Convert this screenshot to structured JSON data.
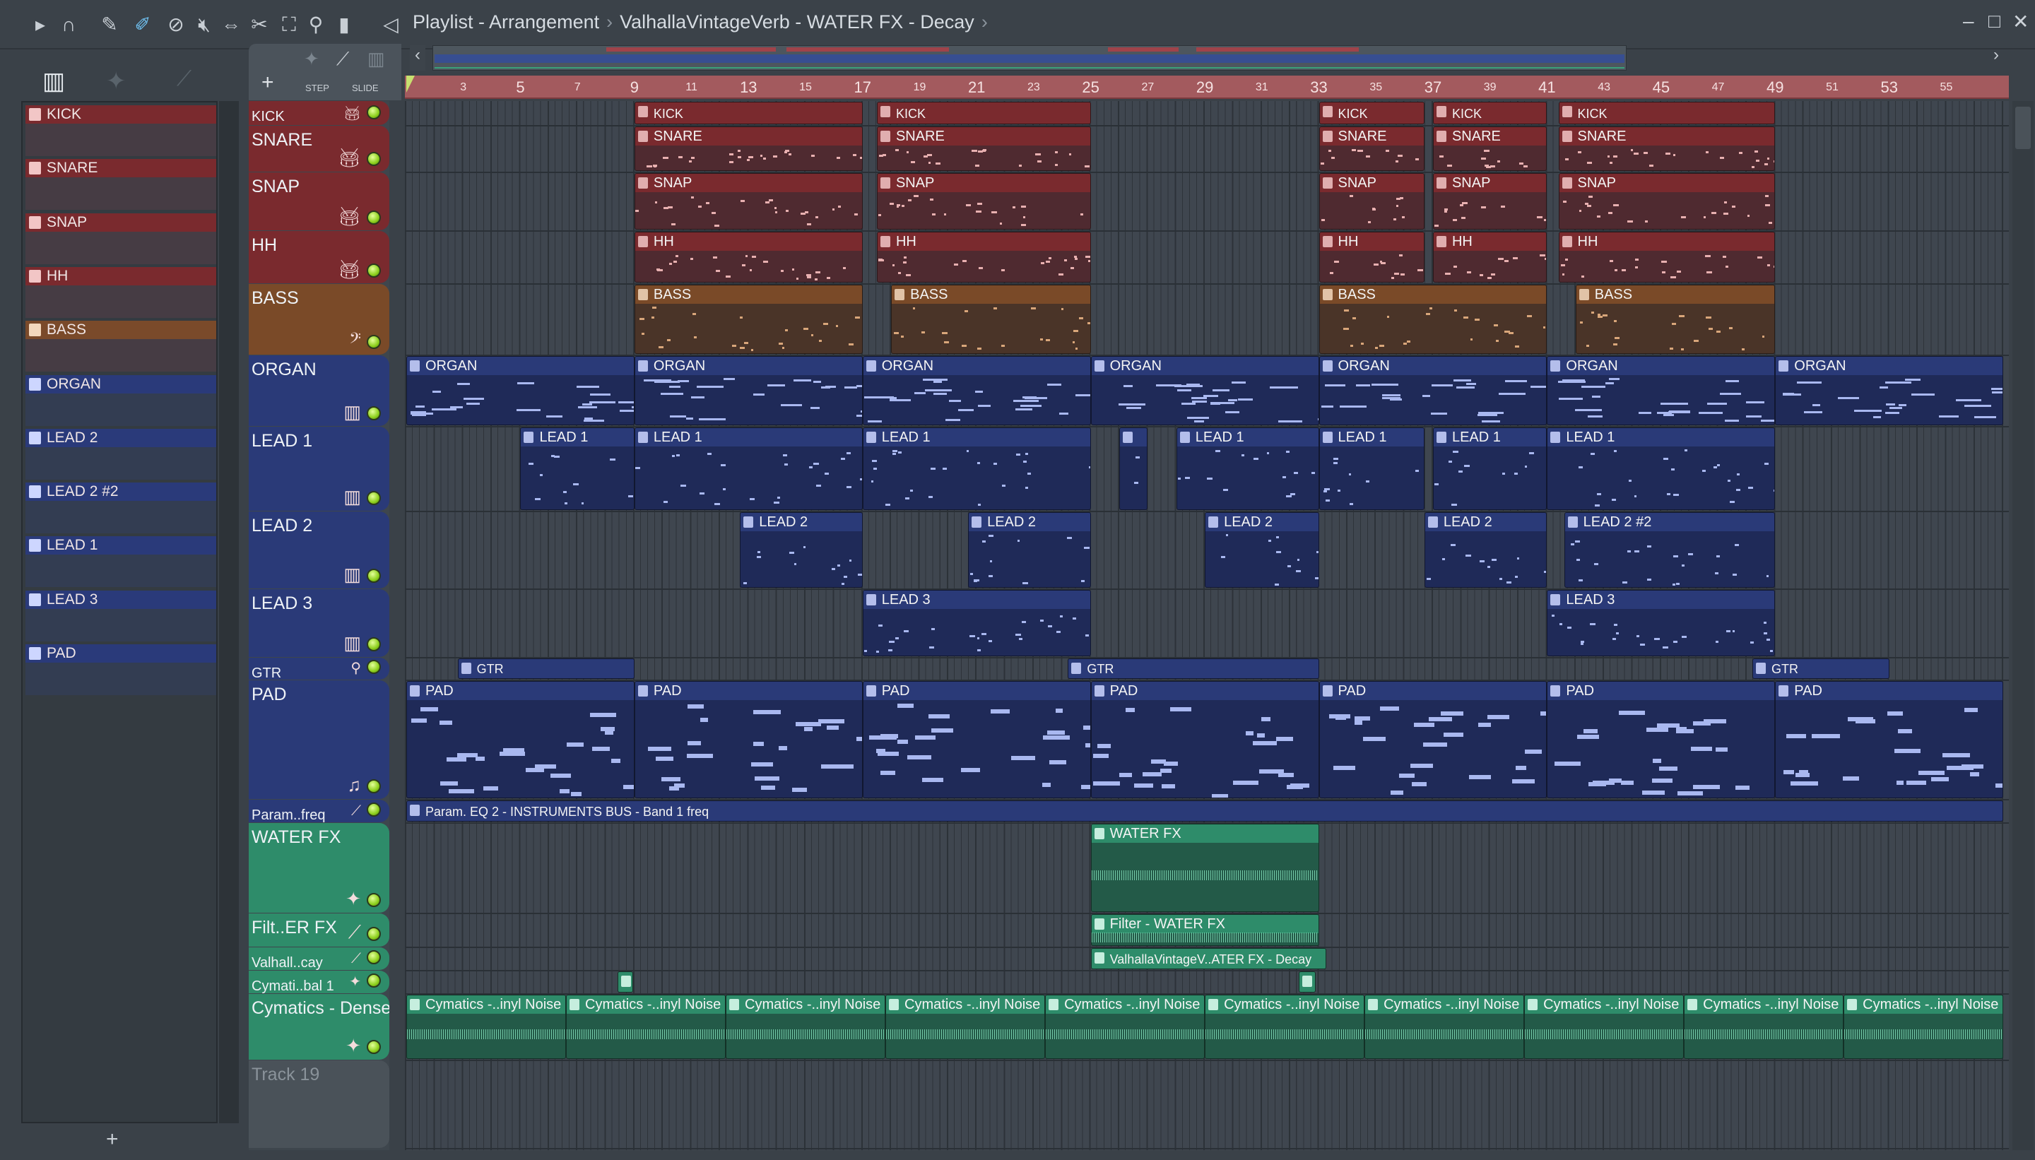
{
  "toolbar": {
    "icons": [
      "play-arrow-icon",
      "magnet-icon",
      "pencil-icon",
      "paint-brush-icon",
      "delete-icon",
      "mute-icon",
      "slip-icon",
      "slice-icon",
      "select-icon",
      "zoom-icon",
      "playback-icon",
      "speaker-icon"
    ],
    "title": "Playlist - Arrangement",
    "subtitle": "ValhallaVintageVerb - WATER FX - Decay",
    "step_label": "STEP",
    "slide_label": "SLIDE",
    "add_label": "+"
  },
  "picker": {
    "items": [
      {
        "name": "KICK",
        "color": "#7a2a2e"
      },
      {
        "name": "SNARE",
        "color": "#7a2a2e"
      },
      {
        "name": "SNAP",
        "color": "#7a2a2e"
      },
      {
        "name": "HH",
        "color": "#7a2a2e"
      },
      {
        "name": "BASS",
        "color": "#7a4a2a"
      },
      {
        "name": "ORGAN",
        "color": "#2a3a7a"
      },
      {
        "name": "LEAD 2",
        "color": "#2a3a7a"
      },
      {
        "name": "LEAD 2 #2",
        "color": "#2a3a7a"
      },
      {
        "name": "LEAD 1",
        "color": "#2a3a7a"
      },
      {
        "name": "LEAD 3",
        "color": "#2a3a7a"
      },
      {
        "name": "PAD",
        "color": "#2a3a7a"
      }
    ],
    "add_label": "+"
  },
  "ruler": {
    "ticks": [
      3,
      5,
      7,
      9,
      11,
      13,
      15,
      17,
      19,
      21,
      23,
      25,
      27,
      29,
      31,
      33,
      35,
      37,
      39,
      41,
      43,
      45,
      47,
      49,
      51,
      53,
      55
    ]
  },
  "colors": {
    "red": "#7a2a2e",
    "brown": "#7a4a28",
    "blue": "#2a3a78",
    "green": "#2e8c6a",
    "ruler": "#a35a5e"
  },
  "tracks": [
    {
      "name": "KICK",
      "kind": "red",
      "icon": "drum-icon",
      "clips": [
        [
          9,
          17,
          "KICK"
        ],
        [
          17.5,
          25,
          "KICK"
        ],
        [
          33,
          36.7,
          "KICK"
        ],
        [
          37,
          41,
          "KICK"
        ],
        [
          41.4,
          49,
          "KICK"
        ]
      ]
    },
    {
      "name": "SNARE",
      "kind": "red",
      "icon": "drum-icon",
      "clips": [
        [
          9,
          17,
          "SNARE"
        ],
        [
          17.5,
          25,
          "SNARE"
        ],
        [
          33,
          36.7,
          "SNARE"
        ],
        [
          37,
          41,
          "SNARE"
        ],
        [
          41.4,
          49,
          "SNARE"
        ]
      ]
    },
    {
      "name": "SNAP",
      "kind": "red",
      "icon": "drum-icon",
      "clips": [
        [
          9,
          17,
          "SNAP"
        ],
        [
          17.5,
          25,
          "SNAP"
        ],
        [
          33,
          36.7,
          "SNAP"
        ],
        [
          37,
          41,
          "SNAP"
        ],
        [
          41.4,
          49,
          "SNAP"
        ]
      ]
    },
    {
      "name": "HH",
      "kind": "red",
      "icon": "drum-icon",
      "clips": [
        [
          9,
          17,
          "HH"
        ],
        [
          17.5,
          25,
          "HH"
        ],
        [
          33,
          36.7,
          "HH"
        ],
        [
          37,
          41,
          "HH"
        ],
        [
          41.4,
          49,
          "HH"
        ]
      ]
    },
    {
      "name": "BASS",
      "kind": "brown",
      "icon": "bass-clef-icon",
      "clips": [
        [
          9,
          17,
          "BASS"
        ],
        [
          18,
          25,
          "BASS"
        ],
        [
          33,
          41,
          "BASS"
        ],
        [
          42,
          49,
          "BASS"
        ]
      ]
    },
    {
      "name": "ORGAN",
      "kind": "blue",
      "icon": "piano-roll-icon",
      "clips": [
        [
          1,
          9,
          "ORGAN"
        ],
        [
          9,
          17,
          "ORGAN"
        ],
        [
          17,
          25,
          "ORGAN"
        ],
        [
          25,
          33,
          "ORGAN"
        ],
        [
          33,
          41,
          "ORGAN"
        ],
        [
          41,
          49,
          "ORGAN"
        ],
        [
          49,
          57,
          "ORGAN"
        ]
      ]
    },
    {
      "name": "LEAD 1",
      "kind": "blue",
      "icon": "piano-roll-icon",
      "clips": [
        [
          5,
          9,
          "LEAD 1"
        ],
        [
          9,
          17,
          "LEAD 1"
        ],
        [
          17,
          25,
          "LEAD 1"
        ],
        [
          26,
          27,
          ""
        ],
        [
          28,
          33,
          "LEAD 1"
        ],
        [
          33,
          36.7,
          "LEAD 1"
        ],
        [
          37,
          41,
          "LEAD 1"
        ],
        [
          41,
          49,
          "LEAD 1"
        ]
      ]
    },
    {
      "name": "LEAD 2",
      "kind": "blue",
      "icon": "piano-roll-icon",
      "clips": [
        [
          12.7,
          17,
          "LEAD 2"
        ],
        [
          20.7,
          25,
          "LEAD 2"
        ],
        [
          29,
          33,
          "LEAD 2"
        ],
        [
          36.7,
          41,
          "LEAD 2"
        ],
        [
          41.6,
          49,
          "LEAD 2 #2"
        ]
      ]
    },
    {
      "name": "LEAD 3",
      "kind": "blue",
      "icon": "piano-roll-icon",
      "clips": [
        [
          17,
          25,
          "LEAD 3"
        ],
        [
          41,
          49,
          "LEAD 3"
        ]
      ]
    },
    {
      "name": "GTR",
      "kind": "blue",
      "icon": "guitar-icon",
      "clips": [
        [
          2.8,
          9,
          "GTR"
        ],
        [
          24.2,
          33,
          "GTR"
        ],
        [
          48.2,
          53,
          "GTR"
        ]
      ]
    },
    {
      "name": "PAD",
      "kind": "blue",
      "icon": "violin-icon",
      "clips": [
        [
          1,
          9,
          "PAD"
        ],
        [
          9,
          17,
          "PAD"
        ],
        [
          17,
          25,
          "PAD"
        ],
        [
          25,
          33,
          "PAD"
        ],
        [
          33,
          41,
          "PAD"
        ],
        [
          41,
          49,
          "PAD"
        ],
        [
          49,
          57,
          "PAD"
        ]
      ]
    },
    {
      "name": "Param..freq",
      "kind": "blue",
      "icon": "automation-icon",
      "clips": [
        [
          1,
          57,
          "Param. EQ 2 - INSTRUMENTS BUS - Band 1 freq"
        ]
      ]
    },
    {
      "name": "WATER FX",
      "kind": "green",
      "icon": "audio-icon",
      "clips": [
        [
          25,
          33,
          "WATER FX"
        ]
      ]
    },
    {
      "name": "Filt..ER FX",
      "kind": "green",
      "icon": "automation-icon",
      "clips": [
        [
          25,
          33,
          "Filter - WATER FX"
        ]
      ]
    },
    {
      "name": "Valhall..cay",
      "kind": "green",
      "icon": "automation-icon",
      "clips": [
        [
          25,
          33.25,
          "ValhallaVintageV..ATER FX - Decay"
        ]
      ]
    },
    {
      "name": "Cymati..bal 1",
      "kind": "green",
      "icon": "audio-icon",
      "clips": [
        [
          8.4,
          8.95,
          ""
        ],
        [
          32.3,
          32.9,
          ""
        ]
      ]
    },
    {
      "name": "Cymatics - Dense..",
      "kind": "green",
      "icon": "audio-icon",
      "clips": [
        [
          1,
          6.6,
          "Cymatics -..inyl Noise"
        ],
        [
          6.6,
          12.2,
          "Cymatics -..inyl Noise"
        ],
        [
          12.2,
          17.8,
          "Cymatics -..inyl Noise"
        ],
        [
          17.8,
          23.4,
          "Cymatics -..inyl Noise"
        ],
        [
          23.4,
          29,
          "Cymatics -..inyl Noise"
        ],
        [
          29,
          34.6,
          "Cymatics -..inyl Noise"
        ],
        [
          34.6,
          40.2,
          "Cymatics -..inyl Noise"
        ],
        [
          40.2,
          45.8,
          "Cymatics -..inyl Noise"
        ],
        [
          45.8,
          51.4,
          "Cymatics -..inyl Noise"
        ],
        [
          51.4,
          57,
          "Cymatics -..inyl Noise"
        ]
      ]
    },
    {
      "name": "Track 19",
      "kind": "empty",
      "icon": "",
      "clips": []
    }
  ]
}
